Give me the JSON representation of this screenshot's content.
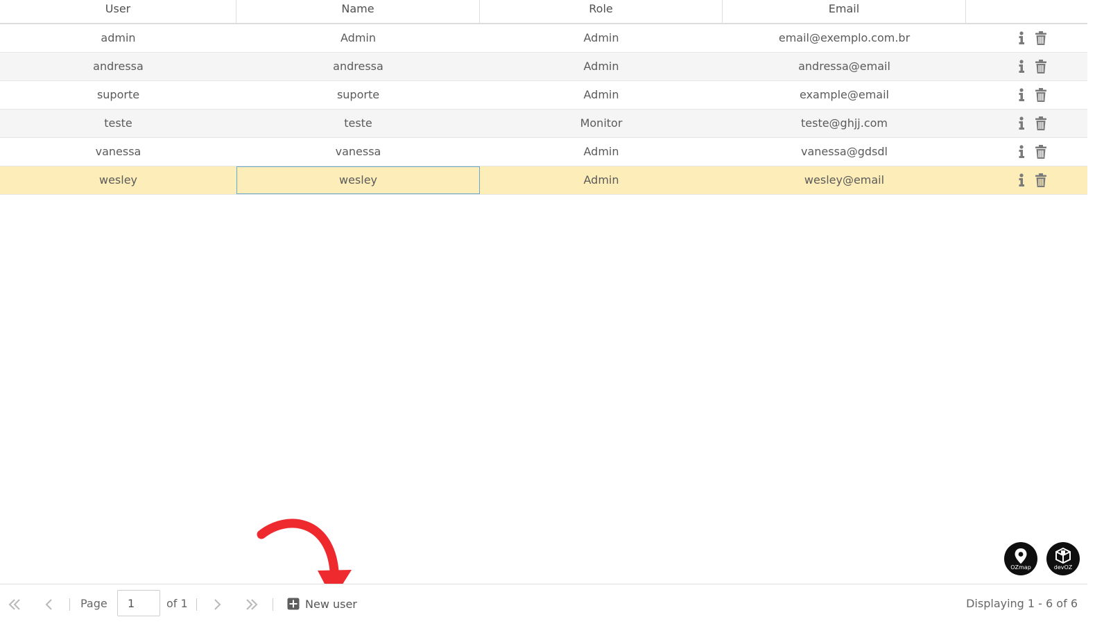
{
  "table": {
    "columns": [
      "User",
      "Name",
      "Role",
      "Email",
      ""
    ],
    "rows": [
      {
        "user": "admin",
        "name": "Admin",
        "role": "Admin",
        "email": "email@exemplo.com.br"
      },
      {
        "user": "andressa",
        "name": "andressa",
        "role": "Admin",
        "email": "andressa@email"
      },
      {
        "user": "suporte",
        "name": "suporte",
        "role": "Admin",
        "email": "example@email"
      },
      {
        "user": "teste",
        "name": "teste",
        "role": "Monitor",
        "email": "teste@ghjj.com"
      },
      {
        "user": "vanessa",
        "name": "vanessa",
        "role": "Admin",
        "email": "vanessa@gdsdl"
      },
      {
        "user": "wesley",
        "name": "wesley",
        "role": "Admin",
        "email": "wesley@email"
      }
    ],
    "selected_row": 5,
    "row_actions": [
      "info-icon",
      "trash-icon"
    ]
  },
  "pager": {
    "page_label": "Page",
    "page_value": "1",
    "of_label": "of 1",
    "new_user_label": "New user",
    "displaying": "Displaying 1 - 6 of 6"
  },
  "badges": {
    "ozmap_label": "OZmap",
    "devoz_label": "devOZ"
  },
  "colors": {
    "selected_row": "#fdeeb9",
    "alt_row": "#f5f5f5",
    "focus_border": "#6aa6c8",
    "arrow": "#ee2a2f"
  }
}
